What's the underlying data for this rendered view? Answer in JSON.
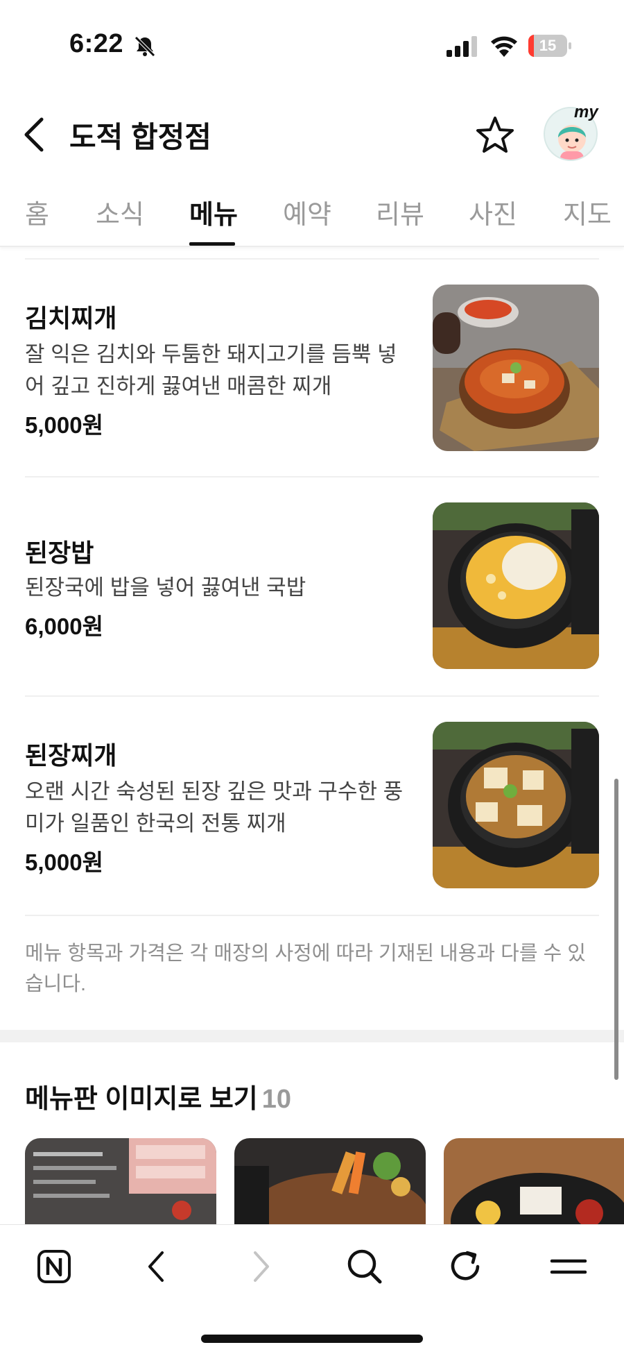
{
  "status_bar": {
    "time": "6:22",
    "battery_level": "15",
    "battery_fraction": 0.15,
    "silent_icon": "bell-slash-icon",
    "signal_icon": "cellular-signal-icon",
    "wifi_icon": "wifi-icon"
  },
  "header": {
    "title": "도적 합정점",
    "back_icon": "chevron-left-icon",
    "favorite_icon": "star-outline-icon",
    "avatar_label": "my"
  },
  "tabs": [
    {
      "label": "홈"
    },
    {
      "label": "소식"
    },
    {
      "label": "메뉴",
      "active": true
    },
    {
      "label": "예약"
    },
    {
      "label": "리뷰"
    },
    {
      "label": "사진"
    },
    {
      "label": "지도"
    }
  ],
  "menu_items": [
    {
      "name": "김치찌개",
      "description": "잘 익은 김치와 두툼한 돼지고기를 듬뿍 넣어 깊고 진하게 끓여낸 매콤한 찌개",
      "price": "5,000원"
    },
    {
      "name": "된장밥",
      "description": "된장국에 밥을 넣어 끓여낸 국밥",
      "price": "6,000원"
    },
    {
      "name": "된장찌개",
      "description": "오랜 시간 숙성된 된장 깊은 맛과 구수한 풍미가 일품인 한국의 전통 찌개",
      "price": "5,000원"
    }
  ],
  "notice": "메뉴 항목과 가격은 각 매장의 사정에 따라 기재된 내용과 다를 수 있습니다.",
  "menu_board": {
    "title": "메뉴판 이미지로 보기",
    "count": "10"
  },
  "colors": {
    "active_tab": "#111111",
    "inactive_tab": "#9a9a9a",
    "battery_low": "#ff3b30",
    "notice_text": "#8f8f8f"
  },
  "bottom_bar": {
    "icons": [
      "naver-home-icon",
      "back-arrow-icon",
      "forward-arrow-icon",
      "search-icon",
      "refresh-icon",
      "menu-icon"
    ]
  }
}
